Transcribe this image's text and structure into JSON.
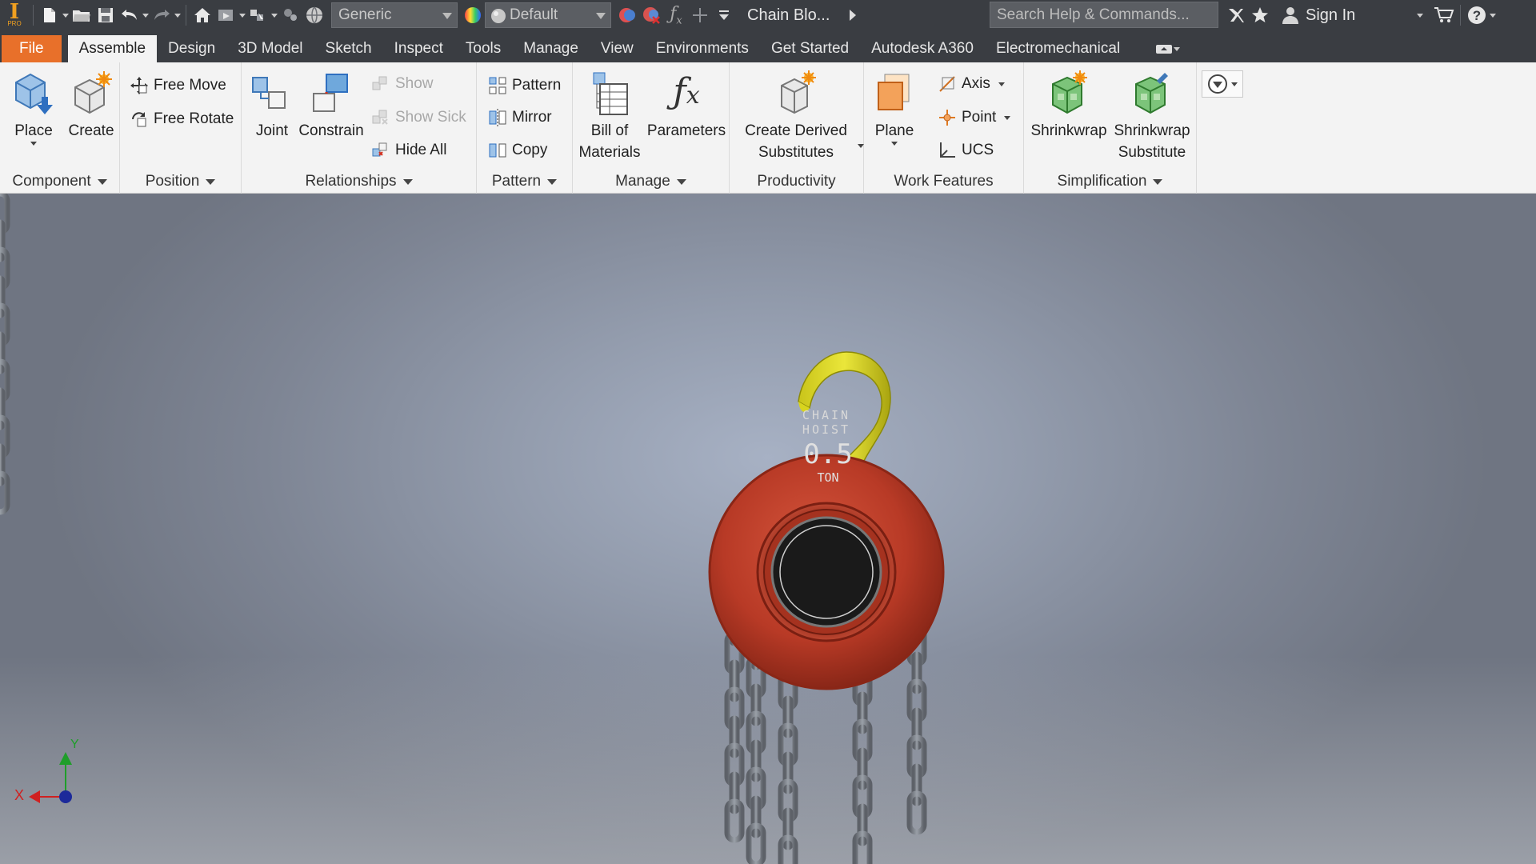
{
  "qat": {
    "app_logo": "I",
    "app_logo_sub": "PRO",
    "material_combo": "Generic",
    "appearance_combo": "Default",
    "document_title": "Chain Blo...",
    "search_placeholder": "Search Help & Commands...",
    "sign_in": "Sign In"
  },
  "tabs": [
    {
      "label": "File"
    },
    {
      "label": "Assemble"
    },
    {
      "label": "Design"
    },
    {
      "label": "3D Model"
    },
    {
      "label": "Sketch"
    },
    {
      "label": "Inspect"
    },
    {
      "label": "Tools"
    },
    {
      "label": "Manage"
    },
    {
      "label": "View"
    },
    {
      "label": "Environments"
    },
    {
      "label": "Get Started"
    },
    {
      "label": "Autodesk A360"
    },
    {
      "label": "Electromechanical"
    }
  ],
  "ribbon": {
    "component": {
      "title": "Component",
      "place": "Place",
      "create": "Create"
    },
    "position": {
      "title": "Position",
      "free_move": "Free Move",
      "free_rotate": "Free Rotate"
    },
    "relationships": {
      "title": "Relationships",
      "joint": "Joint",
      "constrain": "Constrain",
      "show": "Show",
      "show_sick": "Show Sick",
      "hide_all": "Hide All"
    },
    "pattern": {
      "title": "Pattern",
      "pattern": "Pattern",
      "mirror": "Mirror",
      "copy": "Copy"
    },
    "manage": {
      "title": "Manage",
      "bom_line1": "Bill of",
      "bom_line2": "Materials",
      "parameters": "Parameters"
    },
    "productivity": {
      "title": "Productivity",
      "cds_line1": "Create Derived",
      "cds_line2": "Substitutes"
    },
    "work_features": {
      "title": "Work Features",
      "plane": "Plane",
      "axis": "Axis",
      "point": "Point",
      "ucs": "UCS"
    },
    "simplification": {
      "title": "Simplification",
      "shrinkwrap": "Shrinkwrap",
      "sws_line1": "Shrinkwrap",
      "sws_line2": "Substitute"
    }
  },
  "model": {
    "label_top": "CHAIN HOIST",
    "label_value": "0.5",
    "label_unit": "TON"
  },
  "triad": {
    "x": "X",
    "y": "Y"
  },
  "colors": {
    "toolbar_bg": "#3a3d42",
    "file_tab": "#e8702a",
    "hoist_body": "#b83a26",
    "hook": "#d8d41e",
    "chain": "#7b7f86"
  }
}
